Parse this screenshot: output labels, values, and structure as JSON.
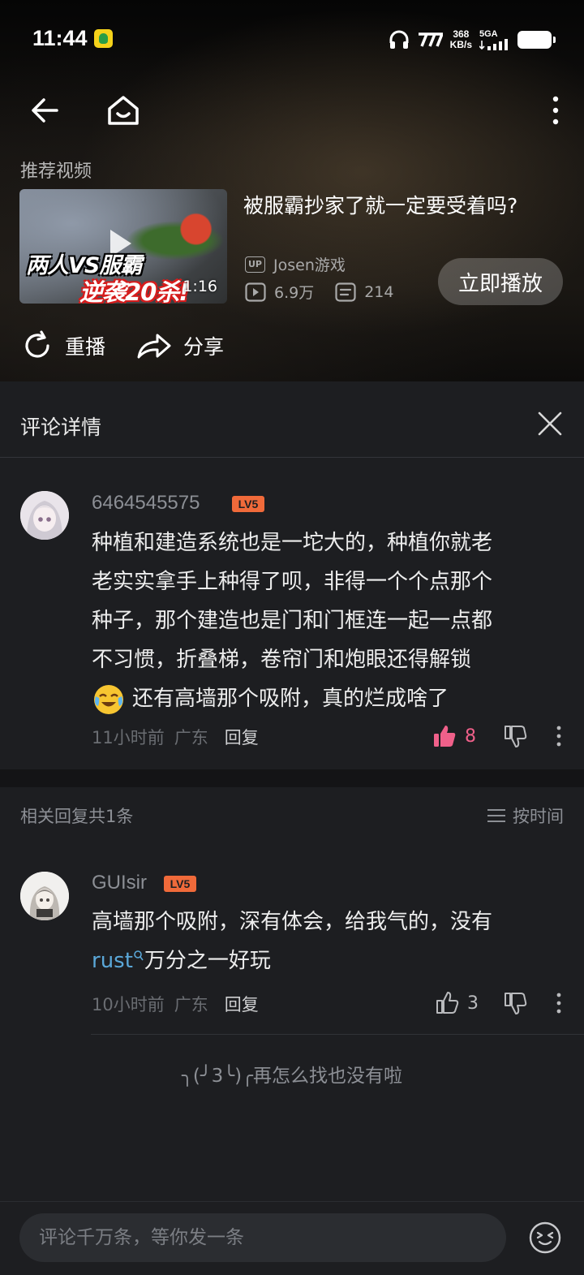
{
  "status_bar": {
    "time": "11:44",
    "speed_value": "368",
    "speed_unit": "KB/s",
    "network": "5GA"
  },
  "recommended": {
    "section_label": "推荐视频",
    "thumbnail_text_line1": "两人VS服霸",
    "thumbnail_text_line2": "逆袭20杀!",
    "duration": "1:16",
    "title": "被服霸抄家了就一定要受着吗?",
    "up_badge": "UP",
    "uploader": "Josen游戏",
    "views": "6.9万",
    "danmaku": "214",
    "play_button": "立即播放"
  },
  "actions": {
    "replay": "重播",
    "share": "分享"
  },
  "panel": {
    "title": "评论详情"
  },
  "main_comment": {
    "username": "6464545575",
    "level": "LV5",
    "text_lines": [
      "种植和建造系统也是一坨大的，种植你就老",
      "老实实拿手上种得了呗，非得一个个点那个",
      "种子，那个建造也是门和门框连一起一点都",
      "不习惯，折叠梯，卷帘门和炮眼还得解锁",
      "还有高墙那个吸附，真的烂成啥了"
    ],
    "time": "11小时前",
    "location": "广东",
    "reply_label": "回复",
    "likes": "8"
  },
  "related": {
    "count_label": "相关回复共1条",
    "sort_label": "按时间"
  },
  "reply": {
    "username": "GUIsir",
    "level": "LV5",
    "text_line1": "高墙那个吸附，深有体会，给我气的，没有",
    "link_text": "rust",
    "text_line2_rest": "万分之一好玩",
    "time": "10小时前",
    "location": "广东",
    "reply_label": "回复",
    "likes": "3"
  },
  "end_message": "╮(╯3╰)╭再怎么找也没有啦",
  "input": {
    "placeholder": "评论千万条，等你发一条"
  },
  "colors": {
    "accent_like": "#f0608a",
    "level_badge": "#f06a3a",
    "link": "#5aa7d8"
  }
}
